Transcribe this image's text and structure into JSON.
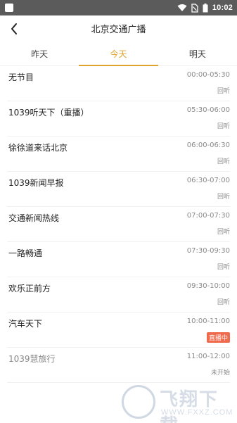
{
  "status_bar": {
    "time": "10:02",
    "icons": [
      "wifi-icon",
      "no-sim-icon",
      "battery-icon"
    ]
  },
  "header": {
    "back_icon": "chevron-left-icon",
    "title": "北京交通广播"
  },
  "tabs": [
    {
      "label": "昨天",
      "active": false
    },
    {
      "label": "今天",
      "active": true
    },
    {
      "label": "明天",
      "active": false
    }
  ],
  "programs": [
    {
      "name": "无节目",
      "time": "00:00-05:30",
      "status": "回听"
    },
    {
      "name": "1039听天下（重播）",
      "time": "05:30-06:00",
      "status": "回听"
    },
    {
      "name": "徐徐道来话北京",
      "time": "06:00-06:30",
      "status": "回听"
    },
    {
      "name": "1039新闻早报",
      "time": "06:30-07:00",
      "status": "回听"
    },
    {
      "name": "交通新闻热线",
      "time": "07:00-07:30",
      "status": "回听"
    },
    {
      "name": "一路畅通",
      "time": "07:30-09:30",
      "status": "回听"
    },
    {
      "name": "欢乐正前方",
      "time": "09:30-10:00",
      "status": "回听"
    },
    {
      "name": "汽车天下",
      "time": "10:00-11:00",
      "status": "直播中"
    },
    {
      "name": "1039慧旅行",
      "time": "11:00-12:00",
      "status": "未开始"
    }
  ],
  "watermark": {
    "text": "飞翔下载",
    "url": "WWW.FXXZ.COM"
  },
  "colors": {
    "accent": "#e0a22c",
    "live_badge": "#f06a4d",
    "status_bar": "#5b5b5b"
  }
}
